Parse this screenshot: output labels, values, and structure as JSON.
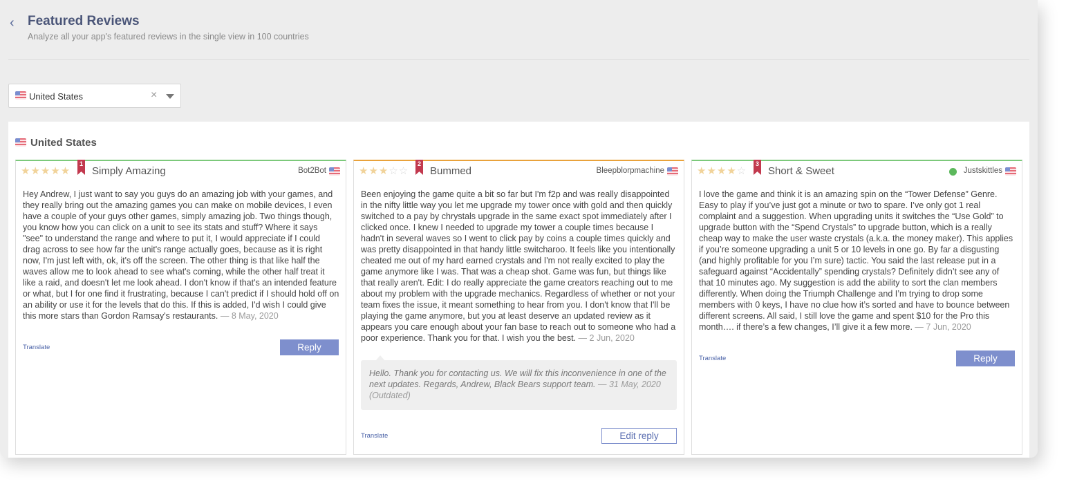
{
  "header": {
    "title": "Featured Reviews",
    "subtitle": "Analyze all your app's featured reviews in the single view in 100 countries"
  },
  "country_select": {
    "value": "United States"
  },
  "panel": {
    "country": "United States"
  },
  "common": {
    "translate_label": "Translate",
    "reply_label": "Reply",
    "edit_reply_label": "Edit reply"
  },
  "reviews": [
    {
      "rank": "1",
      "rating": 5,
      "title": "Simply Amazing",
      "author": "Bot2Bot",
      "accent": "#7cc97b",
      "text": "Hey Andrew, I just want to say you guys do an amazing job with your games, and they really bring out the amazing games you can make on mobile devices, I even have a couple of your guys other games, simply amazing job. Two things though, you know how you can click on a unit to see its stats and stuff? Where it says \"see\" to understand the range and where to put it, I would appreciate if I could drag across to see how far the unit's range actually goes, because as it is right now, I'm just left with, ok, it's off the screen. The other thing is that like half the waves allow me to look ahead to see what's coming, while the other half treat it like a raid, and doesn't let me look ahead. I don't know if that's an intended feature or what, but I for one find it frustrating, because I can't predict if I should hold off on an ability or use it for the levels that do this. If this is added, I'd wish I could give this more stars than Gordon Ramsay's restaurants.",
      "date": "— 8 May, 2020"
    },
    {
      "rank": "2",
      "rating": 3,
      "title": "Bummed",
      "author": "Bleepblorpmachine",
      "accent": "#e9a23b",
      "text": "Been enjoying the game quite a bit so far but I'm f2p and was really disappointed in the nifty little way you let me upgrade my tower once with gold and then quickly switched to a pay by chrystals upgrade in the same exact spot immediately after I clicked once. I knew I needed to upgrade my tower a couple times because I hadn't in several waves so I went to click pay by coins a couple times quickly and was pretty disappointed in that handy little switcharoo. It feels like you intentionally cheated me out of my hard earned crystals and I'm not really excited to play the game anymore like I was. That was a cheap shot. Game was fun, but things like that really aren't. Edit: I do really appreciate the game creators reaching out to me about my problem with the upgrade mechanics. Regardless of whether or not your team fixes the issue, it meant something to hear from you. I don't know that I'll be playing the game anymore, but you at least deserve an updated review as it appears you care enough about your fan base to reach out to someone who had a poor experience. Thank you for that. I wish you the best.",
      "date": "— 2 Jun, 2020",
      "dev_reply": {
        "text": "Hello. Thank you for contacting us. We will fix this inconvenience in one of the next updates. Regards, Andrew, Black Bears support team.",
        "date": "— 31 May, 2020 (Outdated)"
      }
    },
    {
      "rank": "3",
      "rating": 4,
      "title": "Short & Sweet",
      "author": "Justskittles",
      "accent": "#7cc97b",
      "text": "I love the game and think it is an amazing spin on the “Tower Defense” Genre. Easy to play if you’ve just got a minute or two to spare. I’ve only got 1 real complaint and a suggestion. When upgrading units it switches the “Use Gold” to upgrade button with the “Spend Crystals” to upgrade button, which is a really cheap way to make the user waste crystals (a.k.a. the money maker). This applies if you’re someone upgrading a unit 5 or 10 levels in one go. By far a disgusting (and highly profitable for you I’m sure) tactic. You said the last release put in a safeguard against “Accidentally” spending crystals? Definitely didn’t see any of that 10 minutes ago. My suggestion is add the ability to sort the clan members differently. When doing the Triumph Challenge and I’m trying to drop some members with 0 keys, I have no clue how it’s sorted and have to bounce between different screens. All said, I still love the game and spent $10 for the Pro this month…. if there’s a few changes, I’ll give it a few more.",
      "date": "— 7 Jun, 2020"
    }
  ]
}
